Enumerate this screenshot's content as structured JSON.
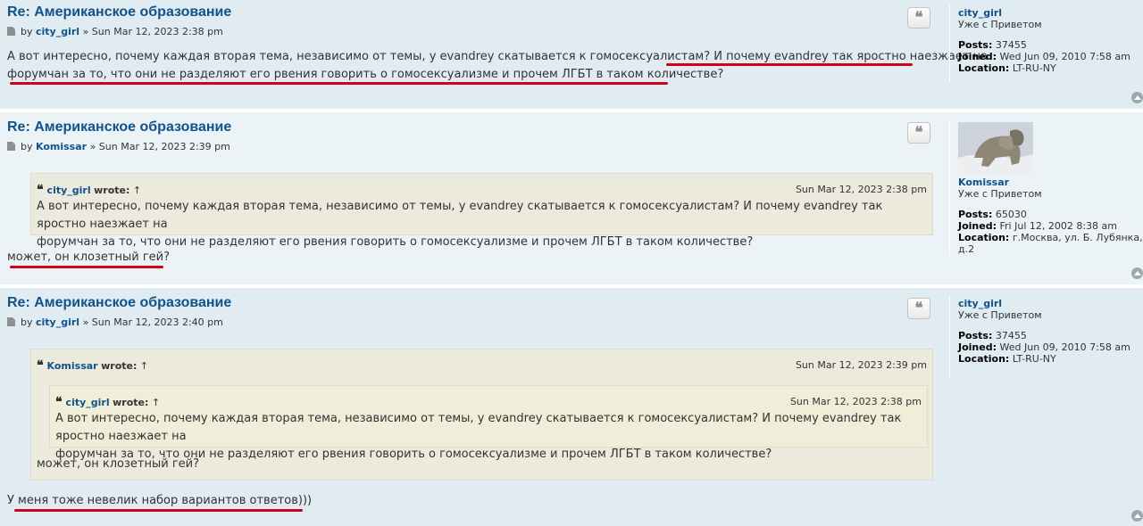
{
  "posts": [
    {
      "title": "Re: Американское образование",
      "by": "by",
      "author": "city_girl",
      "sep": "»",
      "date": "Sun Mar 12, 2023 2:38 pm",
      "body_line1": "А вот интересно, почему каждая вторая тема, независимо от темы, у evandrey скатывается к гомосексуалистам? И почему evandrey так яростно наезжает на",
      "body_line2": "форумчан за то, что они не разделяют его рвения говорить о гомосексуализме и прочем ЛГБТ в таком количестве?",
      "profile": {
        "username": "city_girl",
        "rank": "Уже с Приветом",
        "posts_label": "Posts:",
        "posts": "37455",
        "joined_label": "Joined:",
        "joined": "Wed Jun 09, 2010 7:58 am",
        "location_label": "Location:",
        "location": "LT-RU-NY"
      }
    },
    {
      "title": "Re: Американское образование",
      "by": "by",
      "author": "Komissar",
      "sep": "»",
      "date": "Sun Mar 12, 2023 2:39 pm",
      "quote": {
        "author": "city_girl",
        "wrote": "wrote:",
        "arrow": "↑",
        "date": "Sun Mar 12, 2023 2:38 pm",
        "line1": "А вот интересно, почему каждая вторая тема, независимо от темы, у evandrey скатывается к гомосексуалистам? И почему evandrey так яростно наезжает на",
        "line2": "форумчан за то, что они не разделяют его рвения говорить о гомосексуализме и прочем ЛГБТ в таком количестве?"
      },
      "body": "может, он клозетный гей?",
      "profile": {
        "username": "Komissar",
        "rank": "Уже с Приветом",
        "posts_label": "Posts:",
        "posts": "65030",
        "joined_label": "Joined:",
        "joined": "Fri Jul 12, 2002 8:38 am",
        "location_label": "Location:",
        "location_line1": "г.Москва, ул. Б. Лубянка,",
        "location_line2": "д.2"
      }
    },
    {
      "title": "Re: Американское образование",
      "by": "by",
      "author": "city_girl",
      "sep": "»",
      "date": "Sun Mar 12, 2023 2:40 pm",
      "quote": {
        "author": "Komissar",
        "wrote": "wrote:",
        "arrow": "↑",
        "date": "Sun Mar 12, 2023 2:39 pm",
        "nested": {
          "author": "city_girl",
          "wrote": "wrote:",
          "arrow": "↑",
          "date": "Sun Mar 12, 2023 2:38 pm",
          "line1": "А вот интересно, почему каждая вторая тема, независимо от темы, у evandrey скатывается к гомосексуалистам? И почему evandrey так яростно наезжает на",
          "line2": "форумчан за то, что они не разделяют его рвения говорить о гомосексуализме и прочем ЛГБТ в таком количестве?"
        },
        "text": "может, он клозетный гей?"
      },
      "body": "У меня тоже невелик набор вариантов ответов)))",
      "profile": {
        "username": "city_girl",
        "rank": "Уже с Приветом",
        "posts_label": "Posts:",
        "posts": "37455",
        "joined_label": "Joined:",
        "joined": "Wed Jun 09, 2010 7:58 am",
        "location_label": "Location:",
        "location": "LT-RU-NY"
      }
    }
  ],
  "icons": {
    "quote_button": "quote-icon",
    "back_to_top": "chevron-up-icon",
    "post_icon": "document-icon"
  },
  "colors": {
    "link": "#105289",
    "underline": "#d0021b",
    "post_bg_a": "#e1ebf2",
    "post_bg_b": "#ecf3f7",
    "quote_bg": "#ebeadd"
  }
}
